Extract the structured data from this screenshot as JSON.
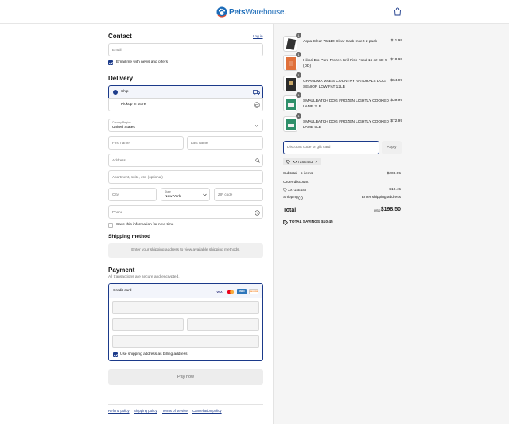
{
  "header": {
    "brand_part1": "Pets",
    "brand_part2": "Warehouse",
    "brand_suffix": "."
  },
  "contact": {
    "title": "Contact",
    "login_link": "Log in",
    "email_placeholder": "Email",
    "email_news_label": "Email me with news and offers",
    "email_news_checked": true
  },
  "delivery": {
    "title": "Delivery",
    "options": [
      {
        "label": "Ship",
        "selected": true,
        "icon": "truck-icon"
      },
      {
        "label": "Pickup in store",
        "selected": false,
        "icon": "store-icon"
      }
    ],
    "country_label": "Country/Region",
    "country_value": "United States",
    "first_name_ph": "First name",
    "last_name_ph": "Last name",
    "address_ph": "Address",
    "apt_ph": "Apartment, suite, etc. (optional)",
    "city_ph": "City",
    "state_label": "State",
    "state_value": "New York",
    "zip_ph": "ZIP code",
    "phone_ph": "Phone",
    "save_info_label": "Save this information for next time",
    "save_info_checked": false
  },
  "shipping_method": {
    "title": "Shipping method",
    "message": "Enter your shipping address to view available shipping methods."
  },
  "payment": {
    "title": "Payment",
    "subtitle": "All transactions are secure and encrypted.",
    "credit_card_label": "Credit card",
    "brands": [
      "VISA",
      "MC",
      "AMEX",
      "DISCOVER"
    ],
    "billing_same_label": "Use shipping address as billing address",
    "billing_same_checked": true,
    "pay_now_label": "Pay now"
  },
  "footer_links": [
    "Refund policy",
    "Shipping policy",
    "Terms of service",
    "Cancellation policy"
  ],
  "order": {
    "items": [
      {
        "qty": "1",
        "name": "Aqua Clear 70/110 Clear Carb Insert 2 pack",
        "price": "$11.99"
      },
      {
        "qty": "1",
        "name": "Hikari Bio-Pure Frozen Krill Fish Food 16 oz SD-5 (DD)",
        "price": "$18.99"
      },
      {
        "qty": "1",
        "name": "GRANDMA MAE'S COUNTRY NATURALS DOG SENIOR LOW FAT 12LB",
        "price": "$64.99"
      },
      {
        "qty": "1",
        "name": "SMALLBATCH DOG FROZEN LIGHTLY COOKED LAMB 2LB",
        "price": "$39.99"
      },
      {
        "qty": "1",
        "name": "SMALLBATCH DOG FROZEN LIGHTLY COOKED LAMB 5LB",
        "price": "$72.99"
      }
    ],
    "discount_placeholder": "Discount code or gift card",
    "apply_label": "Apply",
    "code_chip": "XX71SE4SJ",
    "subtotal_label": "Subtotal · 5 items",
    "subtotal_value": "$208.95",
    "order_discount_label": "Order discount",
    "discount_code": "XX71SE4SJ",
    "discount_value": "− $10.45",
    "shipping_label": "Shipping",
    "shipping_value": "Enter shipping address",
    "total_label": "Total",
    "currency": "USD",
    "total_value": "$198.50",
    "savings_label": "TOTAL SAVINGS",
    "savings_value": "$10.45"
  }
}
